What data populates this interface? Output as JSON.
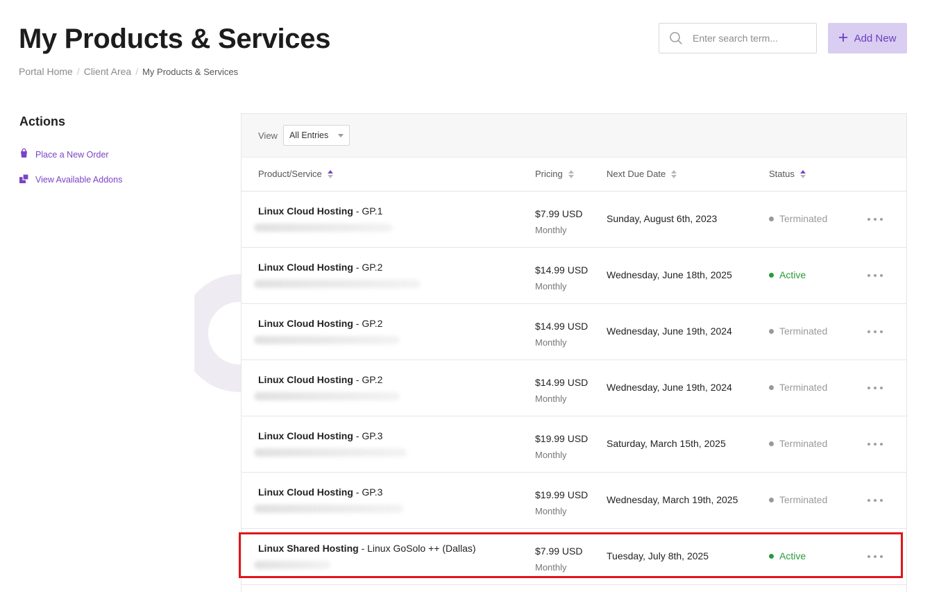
{
  "header": {
    "title": "My Products & Services",
    "breadcrumb": [
      "Portal Home",
      "Client Area",
      "My Products & Services"
    ],
    "separator": "/"
  },
  "search": {
    "placeholder": "Enter search term..."
  },
  "add_button": {
    "label": "Add New",
    "icon": "plus-icon"
  },
  "sidebar": {
    "title": "Actions",
    "links": [
      {
        "label": "Place a New Order",
        "icon": "cart-icon"
      },
      {
        "label": "View Available Addons",
        "icon": "addons-icon"
      }
    ]
  },
  "filter": {
    "label": "View",
    "selected": "All Entries"
  },
  "table": {
    "columns": [
      "Product/Service",
      "Pricing",
      "Next Due Date",
      "Status"
    ],
    "rows": [
      {
        "product": "Linux Cloud Hosting",
        "plan": " - GP.1",
        "price": "$7.99 USD",
        "cycle": "Monthly",
        "due": "Sunday, August 6th, 2023",
        "status": "Terminated"
      },
      {
        "product": "Linux Cloud Hosting",
        "plan": " - GP.2",
        "price": "$14.99 USD",
        "cycle": "Monthly",
        "due": "Wednesday, June 18th, 2025",
        "status": "Active"
      },
      {
        "product": "Linux Cloud Hosting",
        "plan": " - GP.2",
        "price": "$14.99 USD",
        "cycle": "Monthly",
        "due": "Wednesday, June 19th, 2024",
        "status": "Terminated"
      },
      {
        "product": "Linux Cloud Hosting",
        "plan": " - GP.2",
        "price": "$14.99 USD",
        "cycle": "Monthly",
        "due": "Wednesday, June 19th, 2024",
        "status": "Terminated"
      },
      {
        "product": "Linux Cloud Hosting",
        "plan": " - GP.3",
        "price": "$19.99 USD",
        "cycle": "Monthly",
        "due": "Saturday, March 15th, 2025",
        "status": "Terminated"
      },
      {
        "product": "Linux Cloud Hosting",
        "plan": " - GP.3",
        "price": "$19.99 USD",
        "cycle": "Monthly",
        "due": "Wednesday, March 19th, 2025",
        "status": "Terminated"
      },
      {
        "product": "Linux Shared Hosting",
        "plan": " - Linux GoSolo ++ (Dallas)",
        "price": "$7.99 USD",
        "cycle": "Monthly",
        "due": "Tuesday, July 8th, 2025",
        "status": "Active"
      }
    ]
  },
  "colors": {
    "accent": "#7a44c6",
    "button_bg": "#d9cdf2",
    "active": "#2a9a3a",
    "terminated": "#9a9a9a",
    "highlight": "#e0151b"
  }
}
